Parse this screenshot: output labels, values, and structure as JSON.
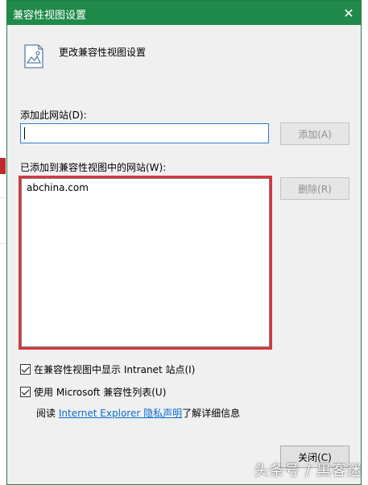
{
  "dialog": {
    "title": "兼容性视图设置",
    "header_text": "更改兼容性视图设置",
    "add_label": "添加此网站(D):",
    "add_input_value": "",
    "add_button": "添加(A)",
    "list_label": "已添加到兼容性视图中的网站(W):",
    "list_items": [
      "abchina.com"
    ],
    "remove_button": "删除(R)",
    "checkbox_intranet": {
      "label": "在兼容性视图中显示 Intranet 站点(I)",
      "checked": true
    },
    "checkbox_microsoft": {
      "label": "使用 Microsoft 兼容性列表(U)",
      "checked": true
    },
    "privacy_prefix": "阅读",
    "privacy_link": "Internet Explorer 隐私声明",
    "privacy_suffix": "了解详细信息",
    "close_button": "关闭(C)"
  },
  "watermark": "头条号 / 黑客迷",
  "colors": {
    "titlebar": "#1f8a49",
    "highlight_border": "#d9363e",
    "link": "#0a6ed1"
  },
  "icons": {
    "close": "close-icon",
    "header": "image-document-icon"
  }
}
